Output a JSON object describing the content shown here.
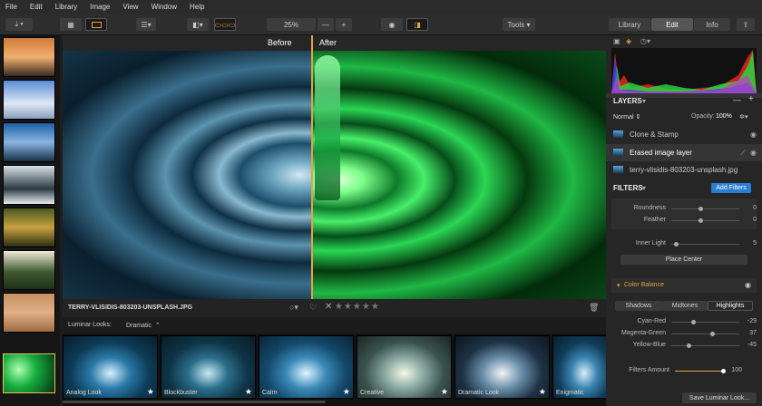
{
  "menu": [
    "File",
    "Edit",
    "Library",
    "Image",
    "View",
    "Window",
    "Help"
  ],
  "toolbar": {
    "zoom": "25%",
    "tools_label": "Tools",
    "tabs": [
      "Library",
      "Edit",
      "Info"
    ],
    "minus": "—",
    "plus": "+"
  },
  "canvas": {
    "before_label": "Before",
    "after_label": "After"
  },
  "info": {
    "filename": "TERRY-VLISIDIS-803203-UNSPLASH.JPG",
    "rating": "★★★★★"
  },
  "looks_bar": {
    "label": "Luminar Looks:",
    "selected": "Dramatic"
  },
  "looks": [
    {
      "name": "Analog Look"
    },
    {
      "name": "Blockbuster"
    },
    {
      "name": "Calm"
    },
    {
      "name": "Creative"
    },
    {
      "name": "Dramatic Look"
    },
    {
      "name": "Enigmatic"
    }
  ],
  "layers": {
    "title": "LAYERS",
    "blend": "Normal",
    "opacity_label": "Opacity:",
    "opacity_value": "100%",
    "items": [
      "Clone & Stamp",
      "Erased image layer",
      "terry-vlisidis-803203-unsplash.jpg"
    ]
  },
  "filters": {
    "title": "FILTERS",
    "add_button": "Add Filters",
    "roundness": {
      "label": "Roundness",
      "value": "0"
    },
    "feather": {
      "label": "Feather",
      "value": "0"
    },
    "inner_light": {
      "label": "Inner Light",
      "value": "5"
    },
    "place_center": "Place Center"
  },
  "color_balance": {
    "title": "Color Balance",
    "tabs": [
      "Shadows",
      "Midtones",
      "Highlights"
    ],
    "cyan_red": {
      "label": "Cyan-Red",
      "value": "-29"
    },
    "magenta_green": {
      "label": "Magenta-Green",
      "value": "37"
    },
    "yellow_blue": {
      "label": "Yellow-Blue",
      "value": "-45"
    }
  },
  "filters_amount": {
    "label": "Filters Amount",
    "value": "100"
  },
  "save_looks": "Save Luminar Look...",
  "colors": {
    "accent": "#e8a040",
    "select": "#e8c34a",
    "add_blue": "#2a7fd4"
  }
}
